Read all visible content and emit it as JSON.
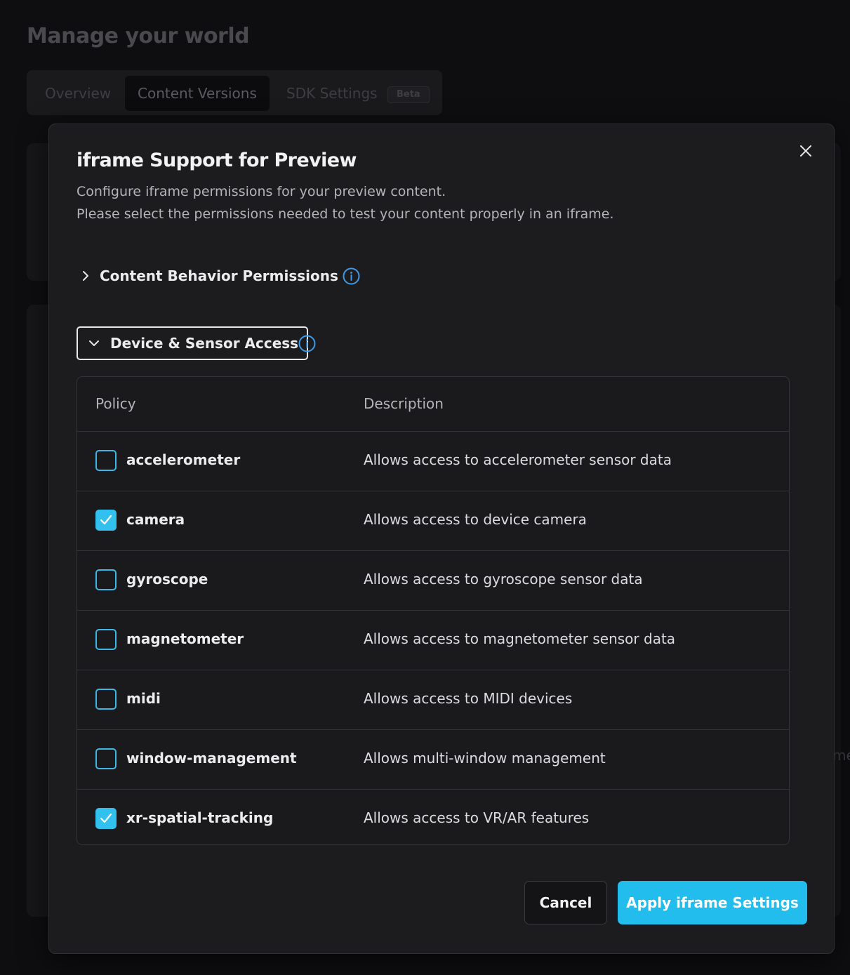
{
  "background": {
    "title": "Manage your world",
    "tabs": [
      {
        "label": "Overview"
      },
      {
        "label": "Content Versions"
      },
      {
        "label": "SDK Settings",
        "badge": "Beta"
      }
    ],
    "fragment_text": "me"
  },
  "modal": {
    "title": "iframe Support for Preview",
    "description_line1": "Configure iframe permissions for your preview content.",
    "description_line2": "Please select the permissions needed to test your content properly in an iframe.",
    "sections": [
      {
        "label": "Content Behavior Permissions",
        "expanded": false
      },
      {
        "label": "Device & Sensor Access",
        "expanded": true
      }
    ],
    "table": {
      "headers": {
        "policy": "Policy",
        "description": "Description"
      },
      "rows": [
        {
          "policy": "accelerometer",
          "description": "Allows access to accelerometer sensor data",
          "checked": false
        },
        {
          "policy": "camera",
          "description": "Allows access to device camera",
          "checked": true
        },
        {
          "policy": "gyroscope",
          "description": "Allows access to gyroscope sensor data",
          "checked": false
        },
        {
          "policy": "magnetometer",
          "description": "Allows access to magnetometer sensor data",
          "checked": false
        },
        {
          "policy": "midi",
          "description": "Allows access to MIDI devices",
          "checked": false
        },
        {
          "policy": "window-management",
          "description": "Allows multi-window management",
          "checked": false
        },
        {
          "policy": "xr-spatial-tracking",
          "description": "Allows access to VR/AR features",
          "checked": true
        }
      ]
    },
    "buttons": {
      "cancel": "Cancel",
      "apply": "Apply iframe Settings"
    }
  },
  "colors": {
    "accent": "#22bdec",
    "checkbox_border": "#3fb7e6",
    "info_icon": "#3d9be9",
    "modal_bg": "#1c1c1f"
  },
  "icons": {
    "close": "close-icon",
    "info": "info-icon",
    "chevron_right": "chevron-right-icon",
    "chevron_down": "chevron-down-icon",
    "check": "check-icon"
  }
}
